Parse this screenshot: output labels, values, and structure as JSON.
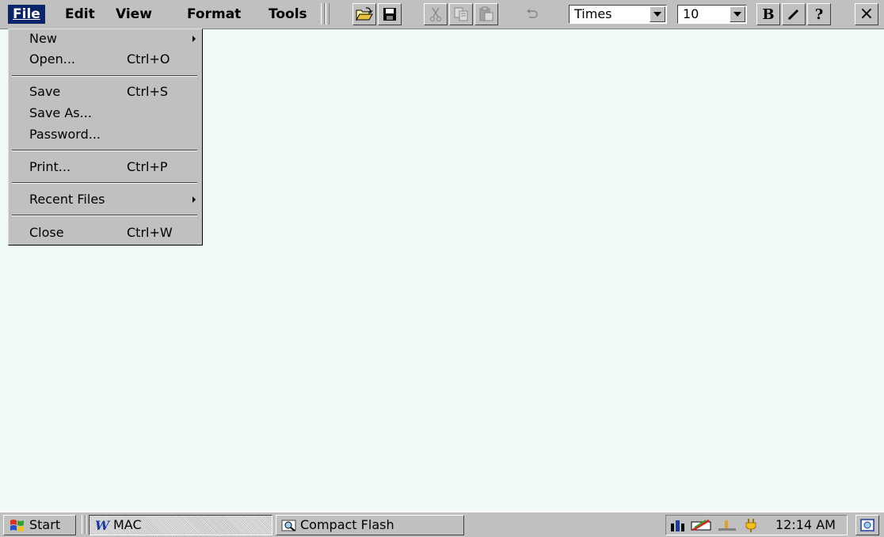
{
  "menu": {
    "file": "File",
    "edit": "Edit",
    "view": "View",
    "format": "Format",
    "tools": "Tools"
  },
  "toolbar": {
    "font_name": "Times",
    "font_size": "10",
    "bold_label": "B",
    "help_label": "?",
    "close_label": "×"
  },
  "file_menu": {
    "new": "New",
    "open": "Open...",
    "open_shortcut": "Ctrl+O",
    "save": "Save",
    "save_shortcut": "Ctrl+S",
    "save_as": "Save As...",
    "password": "Password...",
    "print": "Print...",
    "print_shortcut": "Ctrl+P",
    "recent_files": "Recent Files",
    "close": "Close",
    "close_shortcut": "Ctrl+W"
  },
  "taskbar": {
    "start": "Start",
    "task1": "MAC",
    "task2": "Compact Flash",
    "clock": "12:14 AM"
  },
  "colors": {
    "menu_highlight": "#0a246a",
    "chrome": "#c0c0c0",
    "document_bg": "#f0fbf6"
  }
}
